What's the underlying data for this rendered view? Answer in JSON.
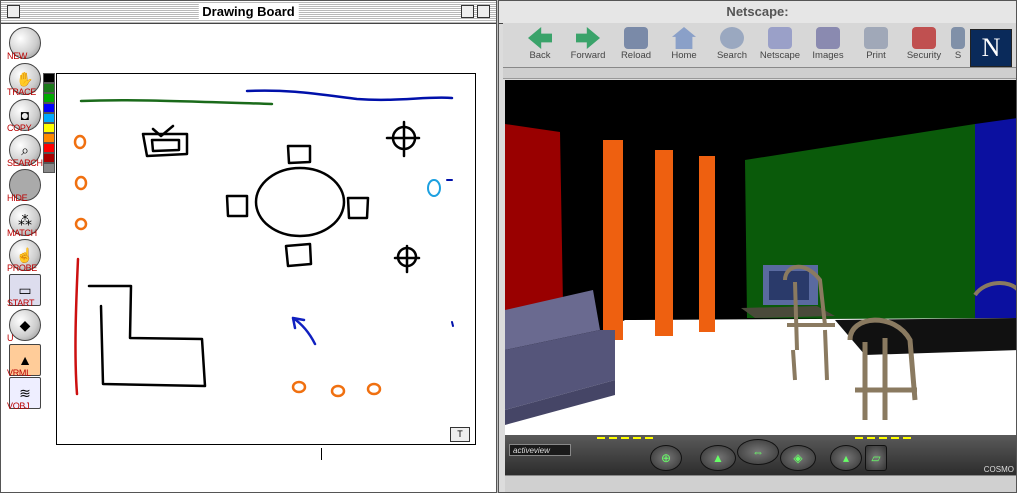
{
  "left_window": {
    "title": "Drawing Board",
    "tools": [
      {
        "label": "NEW",
        "icon": "new-icon"
      },
      {
        "label": "TRACE",
        "icon": "trace-icon"
      },
      {
        "label": "COPY",
        "icon": "camera-icon"
      },
      {
        "label": "SEARCH",
        "icon": "magnifier-icon"
      },
      {
        "label": "HIDE",
        "icon": "hide-icon"
      },
      {
        "label": "MATCH",
        "icon": "match-icon"
      },
      {
        "label": "PROBE",
        "icon": "hand-icon"
      },
      {
        "label": "START",
        "icon": "start-icon"
      },
      {
        "label": "U",
        "icon": "shapes-icon"
      },
      {
        "label": "VRML",
        "icon": "vrml-icon"
      },
      {
        "label": "VOBJ",
        "icon": "vobj-icon"
      }
    ],
    "palette_colors": [
      "#000000",
      "#1a7a1a",
      "#00aa00",
      "#0000ff",
      "#00aaff",
      "#ffff00",
      "#ff8800",
      "#ff0000",
      "#aa0000",
      "#888888"
    ],
    "canvas_button": "T"
  },
  "right_window": {
    "title": "Netscape:",
    "toolbar": [
      {
        "label": "Back",
        "icon": "back-arrow-icon",
        "color": "#3aa36a"
      },
      {
        "label": "Forward",
        "icon": "forward-arrow-icon",
        "color": "#3aa36a"
      },
      {
        "label": "Reload",
        "icon": "reload-icon",
        "color": "#7a8aa8"
      },
      {
        "label": "Home",
        "icon": "home-icon",
        "color": "#8aa0c8"
      },
      {
        "label": "Search",
        "icon": "search-icon",
        "color": "#9aa8c0"
      },
      {
        "label": "Netscape",
        "icon": "netscape-icon",
        "color": "#9aa0c8"
      },
      {
        "label": "Images",
        "icon": "images-icon",
        "color": "#8a8ab0"
      },
      {
        "label": "Print",
        "icon": "print-icon",
        "color": "#a0a8b8"
      },
      {
        "label": "Security",
        "icon": "lock-icon",
        "color": "#c05050"
      },
      {
        "label": "S",
        "icon": "shop-icon",
        "color": "#8090a8"
      }
    ],
    "logo": "N",
    "viewer": {
      "activeview_label": "activeview",
      "brand": "COSMO"
    }
  }
}
